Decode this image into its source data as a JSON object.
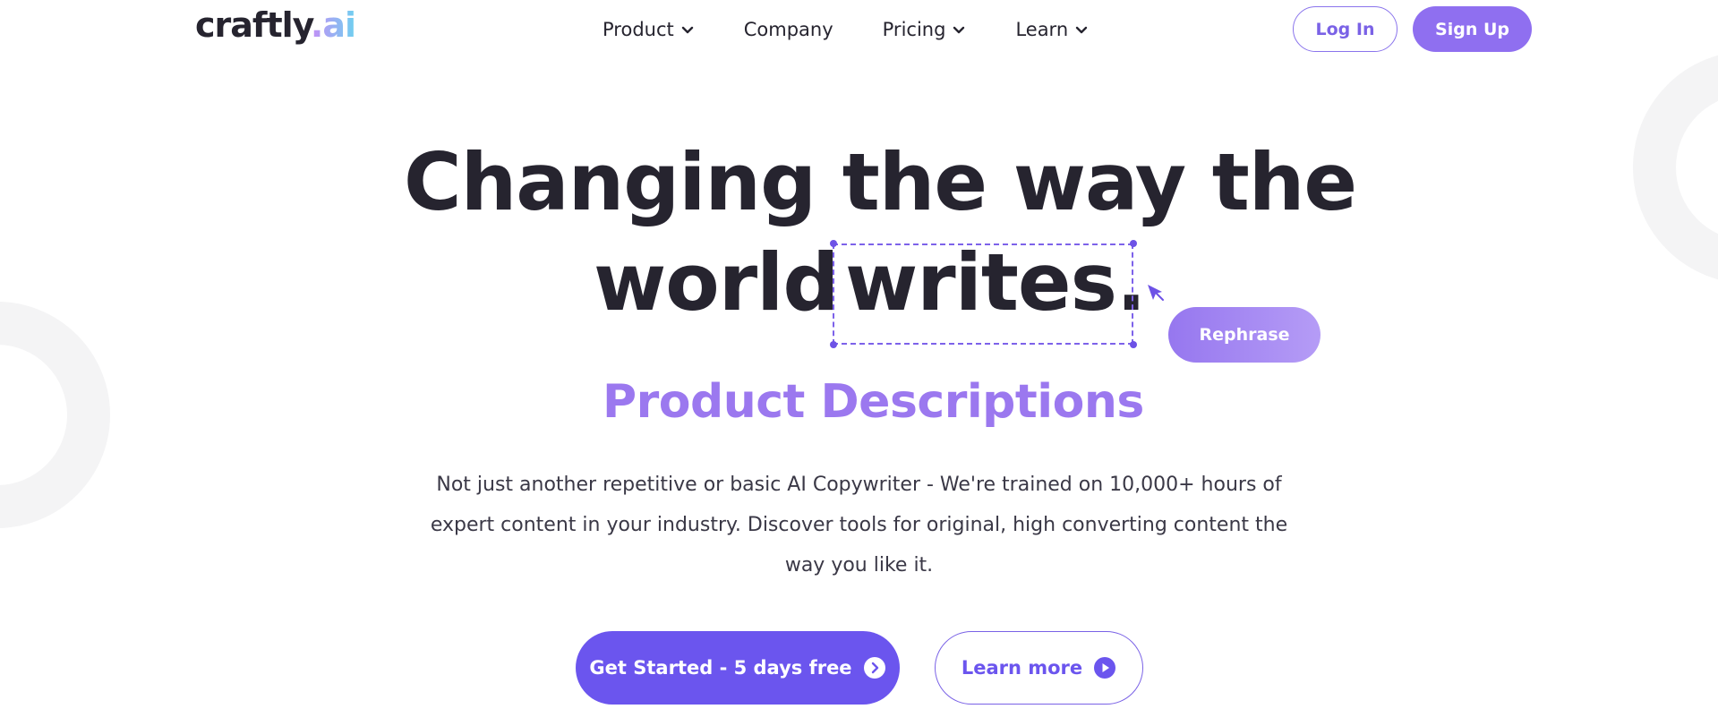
{
  "header": {
    "logo_text": "craftly",
    "logo_suffix": ".ai",
    "nav": [
      {
        "label": "Product",
        "icon": "chevron-down-icon"
      },
      {
        "label": "Company"
      },
      {
        "label": "Pricing",
        "icon": "chevron-down-icon"
      },
      {
        "label": "Learn",
        "icon": "chevron-down-icon"
      }
    ],
    "login_label": "Log In",
    "signup_label": "Sign Up"
  },
  "hero": {
    "line1": "Changing the way the",
    "line2_start": "world",
    "line2_selected": "writes.",
    "rephrase_label": "Rephrase",
    "subheading": "Product Descriptions",
    "description": "Not just another repetitive or basic AI Copywriter - We're trained on 10,000+ hours of expert content in your industry. Discover tools for original, high converting content the way you like it.",
    "cta_primary": "Get Started - 5 days free",
    "cta_primary_icon": "chevron-right-circle-icon",
    "cta_secondary": "Learn more",
    "cta_secondary_icon": "play-circle-icon"
  },
  "colors": {
    "brand_purple": "#6b55ee",
    "accent_purple": "#9b78ef",
    "text_dark": "#26242f"
  }
}
